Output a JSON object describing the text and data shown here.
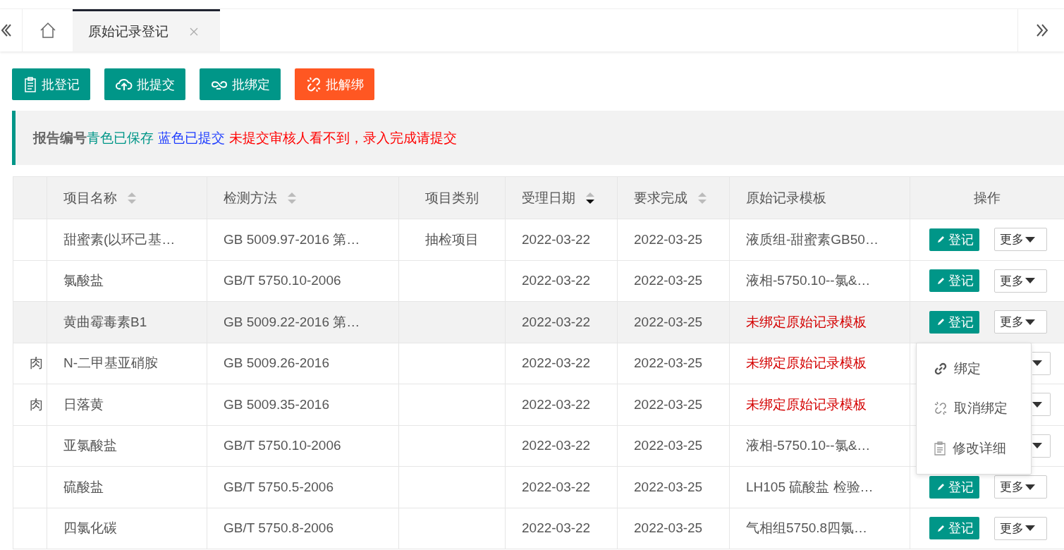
{
  "tabs": [
    {
      "label": "原始记录登记",
      "selected": true,
      "close_icon": true
    }
  ],
  "toolbar": [
    {
      "label": "批登记",
      "kind": "register"
    },
    {
      "label": "批提交",
      "kind": "submit"
    },
    {
      "label": "批绑定",
      "kind": "bind"
    },
    {
      "label": "批解绑",
      "kind": "unbind"
    }
  ],
  "notice": [
    {
      "text": "报告编号",
      "color": "#666666",
      "bold": true
    },
    {
      "text": "青色已保存",
      "color": "#009688",
      "bold": false
    },
    {
      "text": "蓝色已提交",
      "color": "#1e3cff",
      "bold": false
    },
    {
      "text": "未提交审核人看不到，录入完成请提交",
      "color": "#ff0000",
      "bold": false
    }
  ],
  "table": {
    "columns": [
      {
        "label": "项目名称",
        "sorted_desc": false
      },
      {
        "label": "检测方法",
        "sorted_desc": false
      },
      {
        "label": "项目类别"
      },
      {
        "label": "受理日期",
        "sorted_desc": true
      },
      {
        "label": "要求完成",
        "sorted_desc": false
      },
      {
        "label": "原始记录模板"
      },
      {
        "label": "操作"
      }
    ],
    "rows": [
      {
        "column_1": "",
        "name": "甜蜜素(以环己基…",
        "method": "GB 5009.97-2016 第…",
        "category": "抽检项目",
        "received": "2022-03-22",
        "due": "2022-03-25",
        "template": "液质组-甜蜜素GB50…",
        "template_bound": true,
        "hovered": false,
        "register": "登记",
        "more": "更多"
      },
      {
        "column_1": "",
        "name": "氯酸盐",
        "method": "GB/T 5750.10-2006",
        "category": "",
        "received": "2022-03-22",
        "due": "2022-03-25",
        "template": "液相-5750.10--氯&…",
        "template_bound": true,
        "hovered": false,
        "register": "登记",
        "more": "更多"
      },
      {
        "column_1": "",
        "name": "黄曲霉毒素B1",
        "method": "GB 5009.22-2016 第…",
        "category": "",
        "received": "2022-03-22",
        "due": "2022-03-25",
        "template": "未绑定原始记录模板",
        "template_bound": false,
        "hovered": true,
        "register": "登记",
        "more": "更多"
      },
      {
        "column_1": "肉",
        "name": "N-二甲基亚硝胺",
        "method": "GB 5009.26-2016",
        "category": "",
        "received": "2022-03-22",
        "due": "2022-03-25",
        "template": "未绑定原始记录模板",
        "template_bound": false,
        "hovered": false
      },
      {
        "column_1": "肉",
        "name": "日落黄",
        "method": "GB 5009.35-2016",
        "category": "",
        "received": "2022-03-22",
        "due": "2022-03-25",
        "template": "未绑定原始记录模板",
        "template_bound": false,
        "hovered": false
      },
      {
        "column_1": "",
        "name": "亚氯酸盐",
        "method": "GB/T 5750.10-2006",
        "category": "",
        "received": "2022-03-22",
        "due": "2022-03-25",
        "template": "液相-5750.10--氯&…",
        "template_bound": true,
        "hovered": false
      },
      {
        "column_1": "",
        "name": "硫酸盐",
        "method": "GB/T 5750.5-2006",
        "category": "",
        "received": "2022-03-22",
        "due": "2022-03-25",
        "template": "LH105 硫酸盐 检验…",
        "template_bound": true,
        "hovered": false,
        "register": "登记",
        "more": "更多"
      },
      {
        "column_1": "",
        "name": "四氯化碳",
        "method": "GB/T 5750.8-2006",
        "category": "",
        "received": "2022-03-22",
        "due": "2022-03-25",
        "template": "气相组5750.8四氯…",
        "template_bound": true,
        "hovered": false,
        "register": "登记",
        "more": "更多"
      }
    ]
  },
  "dropdown_menu": [
    {
      "label": "绑定",
      "kind": "bind"
    },
    {
      "label": "取消绑定",
      "kind": "unbind"
    },
    {
      "label": "修改详细",
      "kind": "edit"
    }
  ]
}
